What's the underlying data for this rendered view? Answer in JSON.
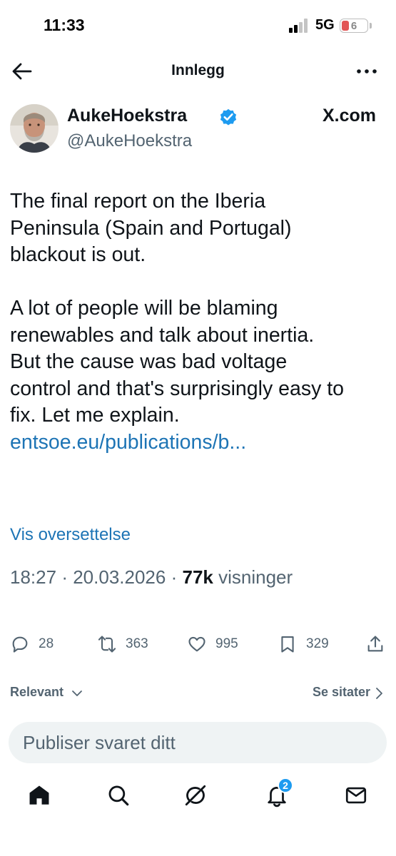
{
  "status_bar": {
    "time": "11:33",
    "network": "5G",
    "battery": "6"
  },
  "header": {
    "title": "Innlegg"
  },
  "post": {
    "author_name": "AukeHoekstra",
    "author_handle": "@AukeHoekstra",
    "source": "X.com",
    "lines": [
      "The final report on the Iberia",
      "Peninsula (Spain and Portugal)",
      "blackout is out.",
      "",
      "A lot of people will be blaming",
      "renewables and talk about inertia.",
      "But the cause was bad voltage",
      "control and that's surprisingly easy to",
      "fix. Let me explain."
    ],
    "link": "entsoe.eu/publications/b...",
    "translate_label": "Vis oversettelse",
    "time": "18:27",
    "date": "20.03.2026",
    "views_count": "77k",
    "views_label": "visninger",
    "separator": "·"
  },
  "actions": {
    "replies": "28",
    "reposts": "363",
    "likes": "995",
    "bookmarks": "329"
  },
  "replies_bar": {
    "sort_label": "Relevant",
    "quotes_label": "Se sitater"
  },
  "reply_box": {
    "placeholder": "Publiser svaret ditt"
  },
  "tab_bar": {
    "notifications_badge": "2"
  },
  "colors": {
    "link_blue": "#1d74b5",
    "verified_blue": "#1d9bf0",
    "secondary_text": "#536471",
    "primary_text": "#0f1419"
  },
  "icons": [
    "back-arrow-icon",
    "more-icon",
    "verified-icon",
    "reply-icon",
    "repost-icon",
    "like-icon",
    "bookmark-icon",
    "share-icon",
    "home-icon",
    "search-icon",
    "grok-icon",
    "notifications-icon",
    "messages-icon"
  ]
}
